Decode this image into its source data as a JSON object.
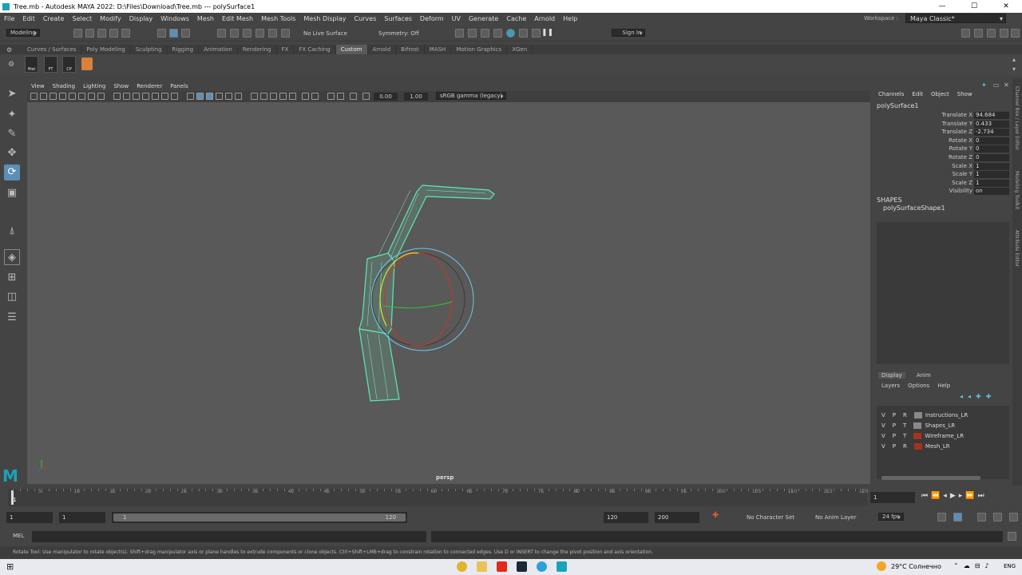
{
  "title": {
    "app": "Tree.mb - Autodesk MAYA 2022: D:\\Files\\Download\\Tree.mb   ---   polySurface1"
  },
  "menu": [
    "File",
    "Edit",
    "Create",
    "Select",
    "Modify",
    "Display",
    "Windows",
    "Mesh",
    "Edit Mesh",
    "Mesh Tools",
    "Mesh Display",
    "Curves",
    "Surfaces",
    "Deform",
    "UV",
    "Generate",
    "Cache",
    "Arnold",
    "Help"
  ],
  "workspace": {
    "label": "Workspace :",
    "value": "Maya Classic*"
  },
  "status": {
    "mode": "Modeling",
    "live": "No Live Surface",
    "symmetry": "Symmetry: Off",
    "signin": "Sign In"
  },
  "shelf_tabs": [
    "Curves / Surfaces",
    "Poly Modeling",
    "Sculpting",
    "Rigging",
    "Animation",
    "Rendering",
    "FX",
    "FX Caching",
    "Custom",
    "Arnold",
    "Bifrost",
    "MASH",
    "Motion Graphics",
    "XGen"
  ],
  "shelf_active": "Custom",
  "shelf_buttons": [
    "Hist",
    "FT",
    "CP"
  ],
  "viewport": {
    "menus": [
      "View",
      "Shading",
      "Lighting",
      "Show",
      "Renderer",
      "Panels"
    ],
    "exposure": "0.00",
    "gamma": "1.00",
    "colorspace": "sRGB gamma (legacy)",
    "camera": "persp"
  },
  "channelbox": {
    "tabs": [
      "Channels",
      "Edit",
      "Object",
      "Show"
    ],
    "object": "polySurface1",
    "attrs": [
      {
        "name": "Translate X",
        "value": "94.684"
      },
      {
        "name": "Translate Y",
        "value": "0.433"
      },
      {
        "name": "Translate Z",
        "value": "-2.734"
      },
      {
        "name": "Rotate X",
        "value": "0"
      },
      {
        "name": "Rotate Y",
        "value": "0"
      },
      {
        "name": "Rotate Z",
        "value": "0"
      },
      {
        "name": "Scale X",
        "value": "1"
      },
      {
        "name": "Scale Y",
        "value": "1"
      },
      {
        "name": "Scale Z",
        "value": "1"
      },
      {
        "name": "Visibility",
        "value": "on"
      }
    ],
    "shapes_label": "SHAPES",
    "shape": "polySurfaceShape1"
  },
  "layers": {
    "tabs": [
      "Display",
      "Anim"
    ],
    "menus": [
      "Layers",
      "Options",
      "Help"
    ],
    "items": [
      {
        "v": "V",
        "p": "P",
        "r": "R",
        "name": "Instructions_LR",
        "color": "#8a8a8a"
      },
      {
        "v": "V",
        "p": "P",
        "r": "T",
        "name": "Shapes_LR",
        "color": "#8a8a8a"
      },
      {
        "v": "V",
        "p": "P",
        "r": "T",
        "name": "Wireframe_LR",
        "color": "#a8321e"
      },
      {
        "v": "V",
        "p": "P",
        "r": "R",
        "name": "Mesh_LR",
        "color": "#a8321e"
      }
    ]
  },
  "side_tabs": [
    "Channel Box / Layer Editor",
    "Modeling Toolkit",
    "Attribute Editor"
  ],
  "timeline": {
    "ticks": [
      "5",
      "10",
      "15",
      "20",
      "25",
      "30",
      "35",
      "40",
      "45",
      "50",
      "55",
      "60",
      "65",
      "70",
      "75",
      "80",
      "85",
      "90",
      "95",
      "100",
      "105",
      "110",
      "115",
      "120"
    ],
    "current": "1",
    "frame_field": "1"
  },
  "range": {
    "start": "1",
    "start2": "1",
    "slider_start": "1",
    "slider_end": "120",
    "end": "120",
    "end2": "200",
    "charset": "No Character Set",
    "animlayer": "No Anim Layer",
    "fps": "24 fps"
  },
  "cmd": {
    "label": "MEL"
  },
  "help": "Rotate Tool: Use manipulator to rotate object(s). Shift+drag manipulator axis or plane handles to extrude components or clone objects. Ctrl+Shift+LMB+drag to constrain rotation to connected edges. Use D or INSERT to change the pivot position and axis orientation.",
  "taskbar": {
    "weather": "29°C  Солнечно",
    "lang": "ENG"
  }
}
